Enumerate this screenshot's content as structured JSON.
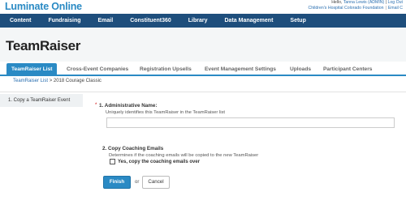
{
  "app": {
    "logo": "Luminate Online"
  },
  "user": {
    "greeting": "Hello,",
    "name": "Tanna Lewis (ADMIN)",
    "separator": "|",
    "logout": "Log Out",
    "org": "Children's Hospital Colorado Foundation",
    "email_link": "Email C"
  },
  "topnav": {
    "items": [
      "Content",
      "Fundraising",
      "Email",
      "Constituent360",
      "Library",
      "Data Management",
      "Setup"
    ]
  },
  "page": {
    "title": "TeamRaiser"
  },
  "tabs": {
    "items": [
      "TeamRaiser List",
      "Cross-Event Companies",
      "Registration Upsells",
      "Event Management Settings",
      "Uploads",
      "Participant Centers"
    ],
    "active_index": 0
  },
  "breadcrumb": {
    "link": "TeamRaiser List",
    "separator": ">",
    "current": "2018 Courage Classic"
  },
  "sidebar": {
    "steps": [
      "1.   Copy a TeamRaiser Event"
    ]
  },
  "form": {
    "required_mark": "*",
    "field1_label": "1. Administrative Name:",
    "field1_help": "Uniquely identifies this TeamRaiser in the TeamRaiser list",
    "field1_value": "",
    "field2_label": "2. Copy Coaching Emails",
    "field2_help": "Determines if the coaching emails will be copied to the new TeamRaiser",
    "checkbox_label": "Yes, copy the coaching emails over",
    "checkbox_checked": false,
    "finish_label": "Finish",
    "or_label": "or",
    "cancel_label": "Cancel"
  },
  "colors": {
    "brand_blue": "#2a8ac4",
    "nav_navy": "#1e4e7c"
  }
}
